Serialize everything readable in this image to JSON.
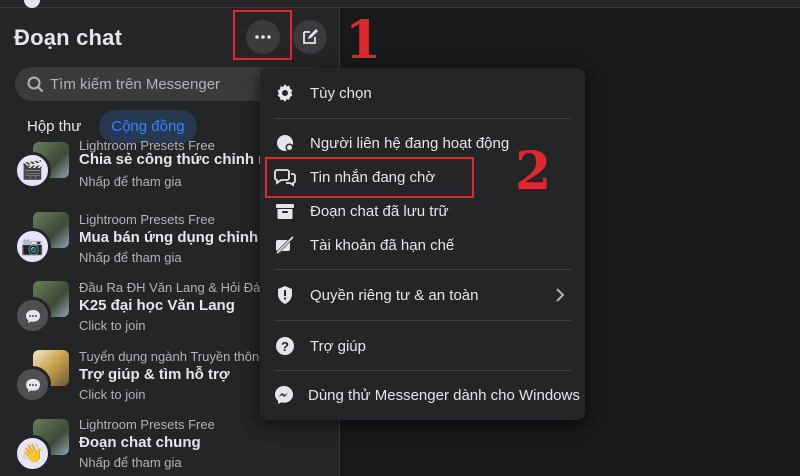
{
  "sidebar": {
    "title": "Đoạn chat",
    "search_placeholder": "Tìm kiếm trên Messenger",
    "tabs": [
      {
        "label": "Hộp thư",
        "active": false
      },
      {
        "label": "Cộng đồng",
        "active": true
      }
    ],
    "chats": [
      {
        "group": "Lightroom Presets Free",
        "name": "Chia sẻ công thức chỉnh màu",
        "hint": "Nhấp để tham gia",
        "avatar_icon": "clapperboard-icon"
      },
      {
        "group": "Lightroom Presets Free",
        "name": "Mua bán ứng dụng chỉnh sửa",
        "hint": "Nhấp để tham gia",
        "avatar_icon": "camera-icon"
      },
      {
        "group": "Đầu Ra ĐH Văn Lang & Hỏi Đáp",
        "name": "K25 đại học Văn Lang",
        "hint": "Click to join",
        "avatar_icon": "chat-bubble-icon"
      },
      {
        "group": "Tuyển dụng ngành Truyền thông",
        "name": "Trợ giúp & tìm hỗ trợ",
        "hint": "Click to join",
        "avatar_icon": "chat-bubble-icon"
      },
      {
        "group": "Lightroom Presets Free",
        "name": "Đoạn chat chung",
        "hint": "Nhấp để tham gia",
        "avatar_icon": "waving-hand-icon"
      }
    ]
  },
  "menu": {
    "items": [
      {
        "label": "Tùy chọn",
        "icon": "gear-icon"
      },
      {
        "label": "Người liên hệ đang hoạt động",
        "icon": "active-contacts-icon"
      },
      {
        "label": "Tin nhắn đang chờ",
        "icon": "message-requests-icon"
      },
      {
        "label": "Đoạn chat đã lưu trữ",
        "icon": "archive-icon"
      },
      {
        "label": "Tài khoản đã hạn chế",
        "icon": "restricted-icon"
      },
      {
        "label": "Quyền riêng tư & an toàn",
        "icon": "shield-icon"
      },
      {
        "label": "Trợ giúp",
        "icon": "help-icon"
      },
      {
        "label": "Dùng thử Messenger dành cho Windows",
        "icon": "messenger-icon"
      }
    ]
  },
  "annotations": {
    "step1": "1",
    "step2": "2",
    "highlight_color": "#e0282f"
  },
  "colors": {
    "accent": "#2d88ff",
    "panel": "#242526",
    "background": "#18191a"
  }
}
